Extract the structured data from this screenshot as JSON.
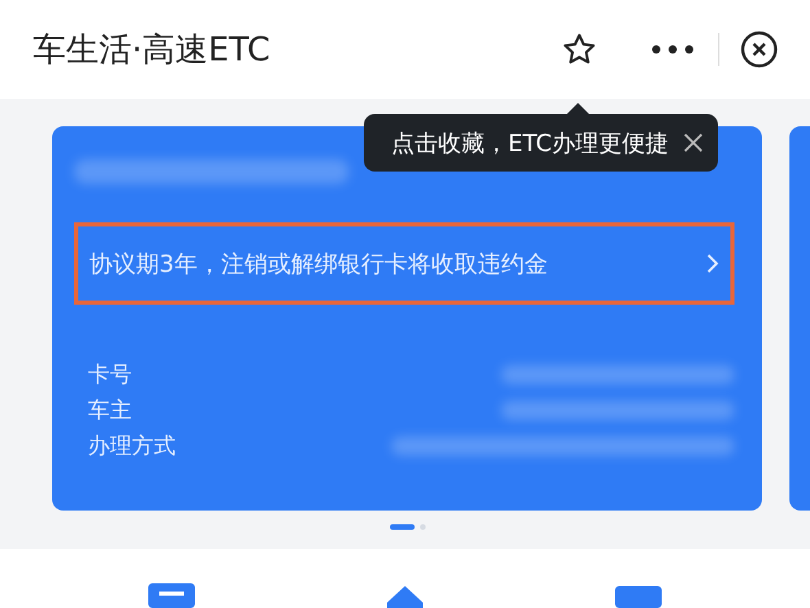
{
  "header": {
    "title": "车生活·高速ETC"
  },
  "tooltip": {
    "text": "点击收藏，ETC办理更便捷"
  },
  "card": {
    "notice": {
      "text": "协议期3年，注销或解绑银行卡将收取违约金",
      "highlighted": true
    },
    "fields": [
      {
        "label": "卡号"
      },
      {
        "label": "车主"
      },
      {
        "label": "办理方式"
      }
    ]
  },
  "carousel": {
    "dots": [
      {
        "selected": true
      },
      {
        "selected": false
      }
    ]
  }
}
